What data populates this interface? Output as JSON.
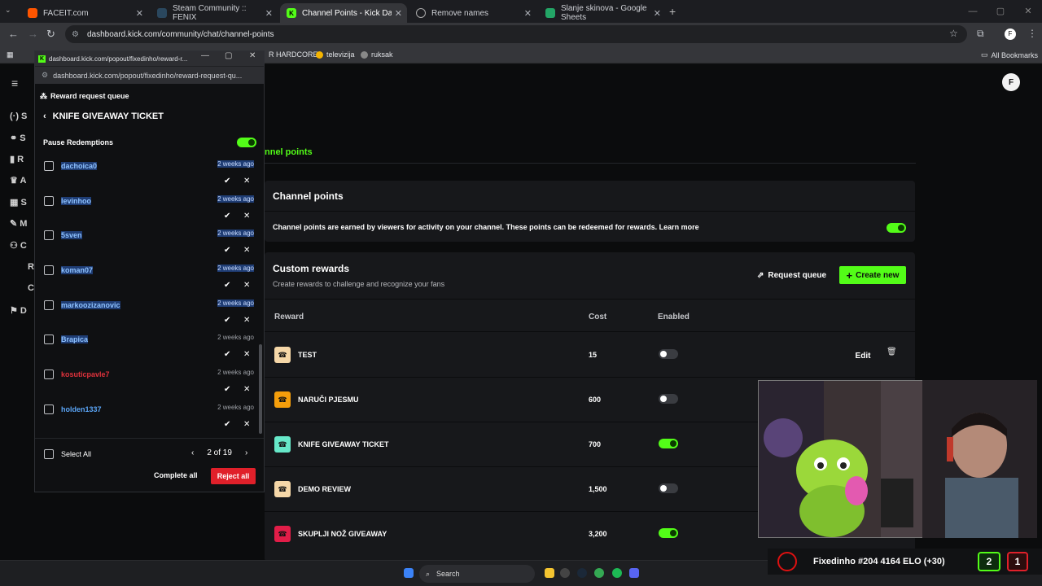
{
  "tabs": [
    {
      "title": "FACEIT.com",
      "favicon": "F",
      "color": "#ff5500"
    },
    {
      "title": "Steam Community :: FENIX",
      "favicon": "S",
      "color": "#1b2838"
    },
    {
      "title": "Channel Points - Kick Dashboard",
      "favicon": "K",
      "color": "#53fc18"
    },
    {
      "title": "Remove names",
      "favicon": "◎",
      "color": "#888888"
    },
    {
      "title": "Slanje skinova - Google Sheets",
      "favicon": "▦",
      "color": "#23a566"
    }
  ],
  "address": {
    "url": "dashboard.kick.com/community/chat/channel-points"
  },
  "bookmarks": {
    "items": [
      "R HARDCORE",
      "televizija",
      "ruksak"
    ],
    "all": "All Bookmarks"
  },
  "leftnav": {
    "items": [
      "S",
      "S",
      "R",
      "A",
      "S",
      "M",
      "C",
      "R",
      "C",
      "D"
    ]
  },
  "main": {
    "tab_label": "nnel points",
    "channel_points": {
      "title": "Channel points",
      "description": "Channel points are earned by viewers for activity on your channel. These points can be redeemed for rewards. Learn more",
      "enabled": true
    },
    "custom_rewards": {
      "title": "Custom rewards",
      "subtitle": "Create rewards to challenge and recognize your fans",
      "request_queue": "Request queue",
      "create_new": "Create new",
      "columns": {
        "reward": "Reward",
        "cost": "Cost",
        "enabled": "Enabled"
      },
      "edit_label": "Edit",
      "rows": [
        {
          "name": "TEST",
          "cost": "15",
          "enabled": false,
          "color": "#f5d7a8"
        },
        {
          "name": "NARUČI PJESMU",
          "cost": "600",
          "enabled": false,
          "color": "#f59e0b"
        },
        {
          "name": "KNIFE GIVEAWAY TICKET",
          "cost": "700",
          "enabled": true,
          "color": "#67e8c9"
        },
        {
          "name": "DEMO REVIEW",
          "cost": "1,500",
          "enabled": false,
          "color": "#f5d7a8"
        },
        {
          "name": "SKUPLJI NOŽ GIVEAWAY",
          "cost": "3,200",
          "enabled": true,
          "color": "#e11d48"
        }
      ]
    }
  },
  "popup": {
    "window_title": "dashboard.kick.com/popout/fixedinho/reward-r...",
    "address": "dashboard.kick.com/popout/fixedinho/reward-request-qu...",
    "queue_title": "Reward request queue",
    "reward_title": "KNIFE GIVEAWAY TICKET",
    "pause_label": "Pause Redemptions",
    "paused": true,
    "requests": [
      {
        "user": "dachoica0",
        "time": "2 weeks ago",
        "selected": true,
        "red": false
      },
      {
        "user": "levinhoo",
        "time": "2 weeks ago",
        "selected": true,
        "red": false
      },
      {
        "user": "5sven",
        "time": "2 weeks ago",
        "selected": true,
        "red": false
      },
      {
        "user": "koman07",
        "time": "2 weeks ago",
        "selected": true,
        "red": false
      },
      {
        "user": "markoozizanovic",
        "time": "2 weeks ago",
        "selected": true,
        "red": false
      },
      {
        "user": "Brapica",
        "time": "2 weeks ago",
        "selected": false,
        "red": false,
        "namesel": true
      },
      {
        "user": "kosuticpavle7",
        "time": "2 weeks ago",
        "selected": false,
        "red": true
      },
      {
        "user": "holden1337",
        "time": "2 weeks ago",
        "selected": false,
        "red": false
      }
    ],
    "select_all": "Select All",
    "pagination": "2 of 19",
    "complete_all": "Complete all",
    "reject_all": "Reject all"
  },
  "elo": {
    "text": "Fixedinho #204 4164 ELO (+30)",
    "wins": "2",
    "losses": "1"
  },
  "taskbar": {
    "search": "Search"
  }
}
